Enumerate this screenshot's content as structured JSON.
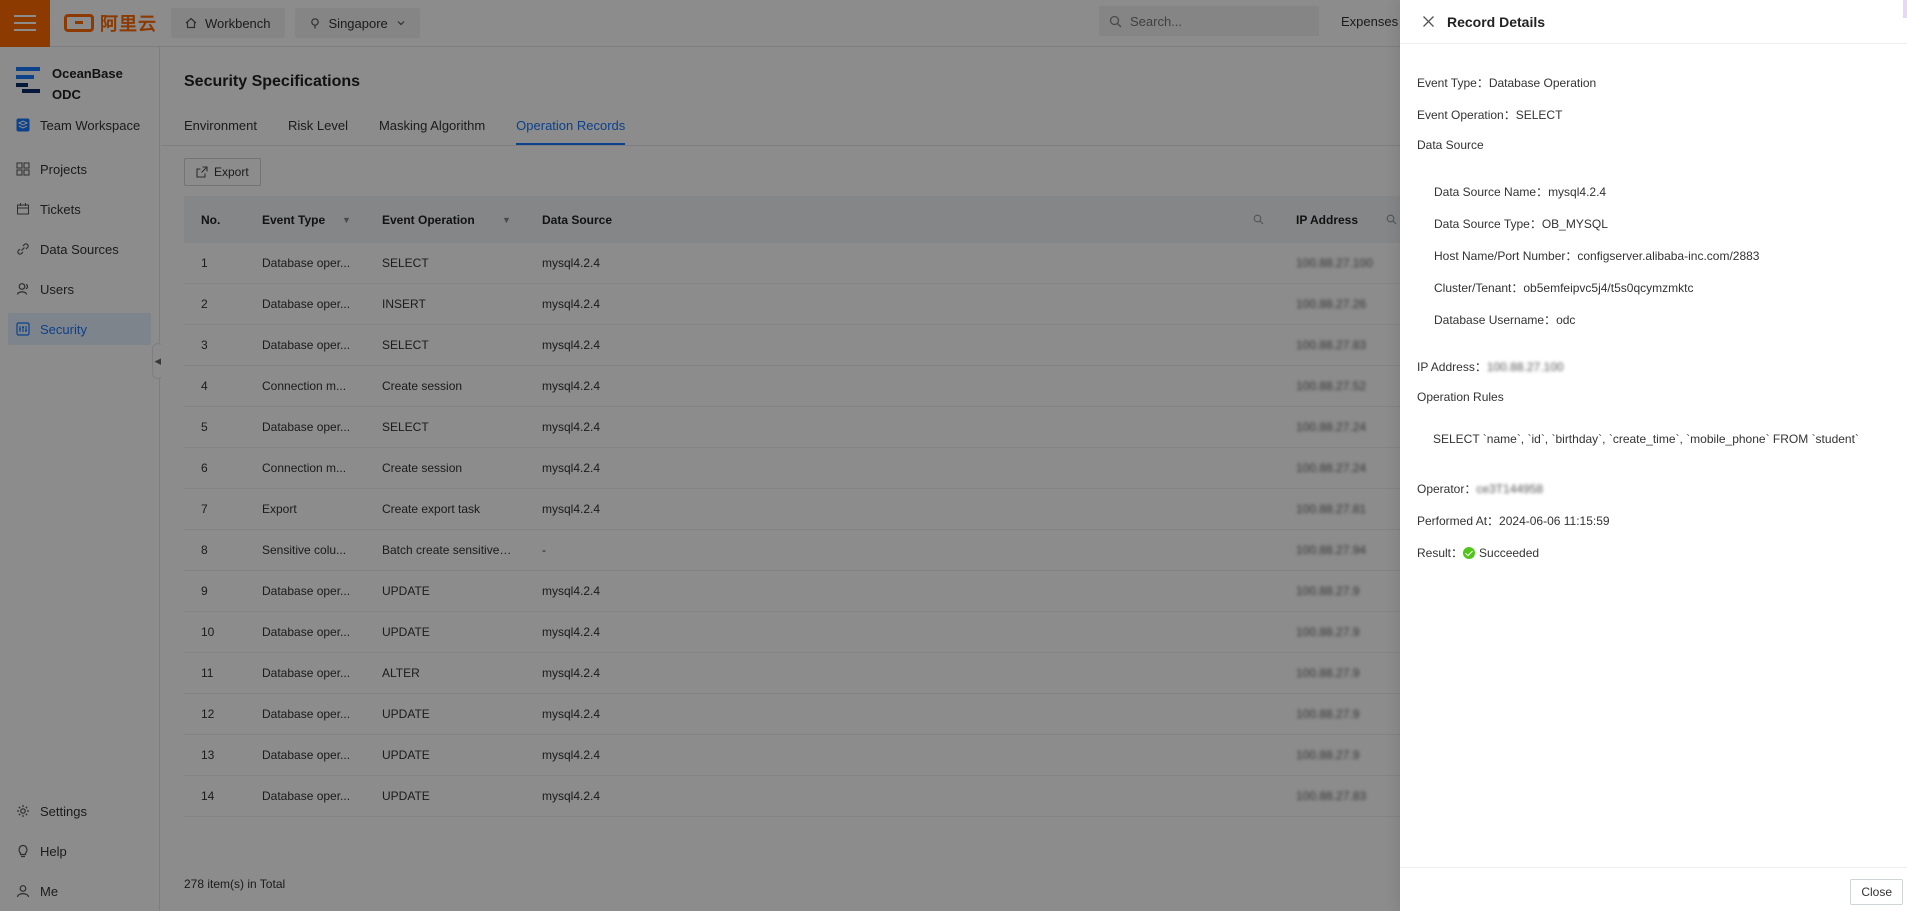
{
  "topbar": {
    "logo_text": "阿里云",
    "workbench_label": "Workbench",
    "region_label": "Singapore",
    "search_placeholder": "Search...",
    "expenses_label": "Expenses"
  },
  "sidebar": {
    "brand_line1": "OceanBase",
    "brand_line2": "ODC",
    "workspace_label": "Team Workspace",
    "items": [
      {
        "label": "Projects",
        "icon": "grid-icon"
      },
      {
        "label": "Tickets",
        "icon": "ticket-icon"
      },
      {
        "label": "Data Sources",
        "icon": "link-icon"
      },
      {
        "label": "Users",
        "icon": "users-icon"
      },
      {
        "label": "Security",
        "icon": "security-icon"
      }
    ],
    "bottom_items": [
      {
        "label": "Settings",
        "icon": "gear-icon"
      },
      {
        "label": "Help",
        "icon": "bulb-icon"
      },
      {
        "label": "Me",
        "icon": "user-icon"
      }
    ]
  },
  "main": {
    "title": "Security Specifications",
    "tabs": [
      "Environment",
      "Risk Level",
      "Masking Algorithm",
      "Operation Records"
    ],
    "active_tab": "Operation Records",
    "export_label": "Export",
    "columns": [
      "No.",
      "Event Type",
      "Event Operation",
      "Data Source",
      "IP Address"
    ],
    "rows": [
      {
        "no": "1",
        "type": "Database oper...",
        "op": "SELECT",
        "ds": "mysql4.2.4",
        "ip": "100.88.27.100"
      },
      {
        "no": "2",
        "type": "Database oper...",
        "op": "INSERT",
        "ds": "mysql4.2.4",
        "ip": "100.88.27.26"
      },
      {
        "no": "3",
        "type": "Database oper...",
        "op": "SELECT",
        "ds": "mysql4.2.4",
        "ip": "100.88.27.83"
      },
      {
        "no": "4",
        "type": "Connection m...",
        "op": "Create session",
        "ds": "mysql4.2.4",
        "ip": "100.88.27.52"
      },
      {
        "no": "5",
        "type": "Database oper...",
        "op": "SELECT",
        "ds": "mysql4.2.4",
        "ip": "100.88.27.24"
      },
      {
        "no": "6",
        "type": "Connection m...",
        "op": "Create session",
        "ds": "mysql4.2.4",
        "ip": "100.88.27.24"
      },
      {
        "no": "7",
        "type": "Export",
        "op": "Create export task",
        "ds": "mysql4.2.4",
        "ip": "100.88.27.81"
      },
      {
        "no": "8",
        "type": "Sensitive colu...",
        "op": "Batch create sensitive ...",
        "ds": "-",
        "ip": "100.88.27.94"
      },
      {
        "no": "9",
        "type": "Database oper...",
        "op": "UPDATE",
        "ds": "mysql4.2.4",
        "ip": "100.88.27.9"
      },
      {
        "no": "10",
        "type": "Database oper...",
        "op": "UPDATE",
        "ds": "mysql4.2.4",
        "ip": "100.88.27.9"
      },
      {
        "no": "11",
        "type": "Database oper...",
        "op": "ALTER",
        "ds": "mysql4.2.4",
        "ip": "100.88.27.9"
      },
      {
        "no": "12",
        "type": "Database oper...",
        "op": "UPDATE",
        "ds": "mysql4.2.4",
        "ip": "100.88.27.9"
      },
      {
        "no": "13",
        "type": "Database oper...",
        "op": "UPDATE",
        "ds": "mysql4.2.4",
        "ip": "100.88.27.9"
      },
      {
        "no": "14",
        "type": "Database oper...",
        "op": "UPDATE",
        "ds": "mysql4.2.4",
        "ip": "100.88.27.83"
      }
    ],
    "total_text": "278 item(s) in Total"
  },
  "drawer": {
    "title": "Record Details",
    "event_type_label": "Event Type：",
    "event_type": "Database Operation",
    "event_operation_label": "Event Operation：",
    "event_operation": "SELECT",
    "data_source_label": "Data Source",
    "ds_name_label": "Data Source Name：",
    "ds_name": "mysql4.2.4",
    "ds_type_label": "Data Source Type：",
    "ds_type": "OB_MYSQL",
    "host_label": "Host Name/Port Number：",
    "host": "configserver.alibaba-inc.com/2883",
    "cluster_label": "Cluster/Tenant：",
    "cluster": "ob5emfeipvc5j4/t5s0qcymzmktc",
    "db_user_label": "Database Username：",
    "db_user": "odc",
    "ip_label": "IP Address：",
    "ip": "100.88.27.100",
    "rules_label": "Operation Rules",
    "rules_sql": "SELECT `name`, `id`, `birthday`, `create_time`, `mobile_phone` FROM `student`",
    "operator_label": "Operator：",
    "operator": "ce3T144958",
    "performed_label": "Performed At：",
    "performed": "2024-06-06 11:15:59",
    "result_label": "Result：",
    "result": "Succeeded",
    "close_label": "Close"
  },
  "colors": {
    "brand_orange": "#ff6a00",
    "accent_blue": "#1677ff",
    "success_green": "#52c41a"
  }
}
